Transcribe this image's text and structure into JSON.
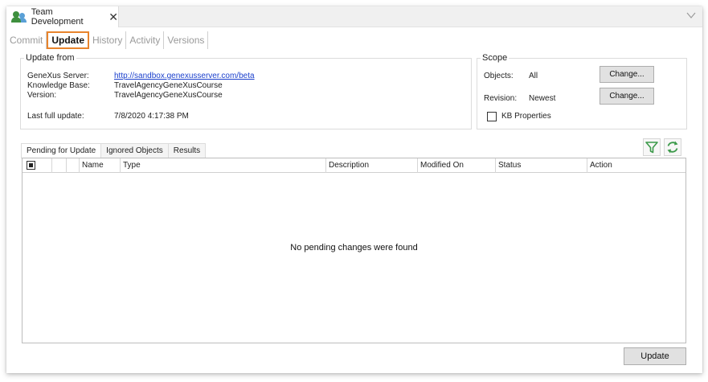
{
  "document_tab": {
    "title": "Team Development",
    "close_glyph": "✕"
  },
  "subtabs": [
    {
      "label": "Commit",
      "active": false
    },
    {
      "label": "Update",
      "active": true
    },
    {
      "label": "History",
      "active": false
    },
    {
      "label": "Activity",
      "active": false
    },
    {
      "label": "Versions",
      "active": false
    }
  ],
  "update_from": {
    "legend": "Update from",
    "server_label": "GeneXus Server:",
    "server_value": "http://sandbox.genexusserver.com/beta",
    "kb_label": "Knowledge Base:",
    "kb_value": "TravelAgencyGeneXusCourse",
    "version_label": "Version:",
    "version_value": "TravelAgencyGeneXusCourse",
    "last_update_label": "Last full update:",
    "last_update_value": "7/8/2020 4:17:38 PM"
  },
  "scope": {
    "legend": "Scope",
    "objects_label": "Objects:",
    "objects_value": "All",
    "revision_label": "Revision:",
    "revision_value": "Newest",
    "change_label_1": "Change...",
    "change_label_2": "Change...",
    "kb_properties_label": "KB Properties",
    "kb_properties_checked": false
  },
  "lower_tabs": [
    {
      "label": "Pending for Update",
      "active": true
    },
    {
      "label": "Ignored Objects",
      "active": false
    },
    {
      "label": "Results",
      "active": false
    }
  ],
  "toolbar_icons": [
    "filter-icon",
    "refresh-icon"
  ],
  "grid": {
    "columns": [
      "Name",
      "Type",
      "Description",
      "Modified On",
      "Status",
      "Action"
    ],
    "empty_message": "No pending changes were found"
  },
  "footer": {
    "update_label": "Update"
  },
  "colors": {
    "active_tab_border": "#e8842c",
    "link": "#1a3fcc",
    "icon_green": "#3c9a4a"
  }
}
